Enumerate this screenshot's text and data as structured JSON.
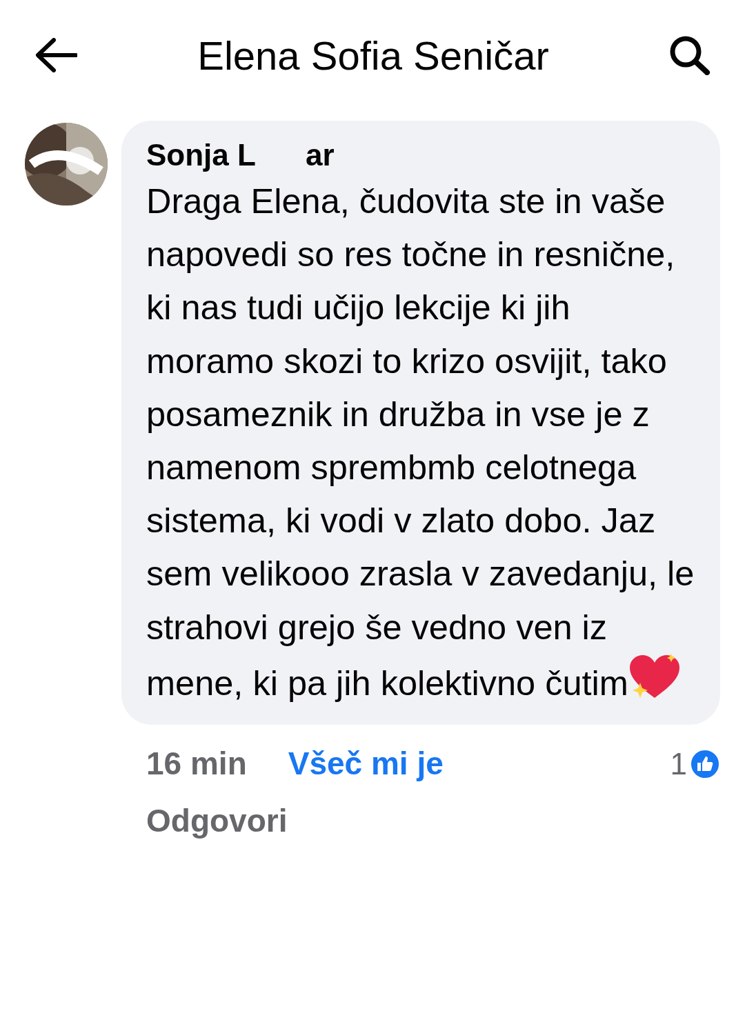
{
  "header": {
    "title": "Elena Sofia Seničar"
  },
  "comment": {
    "author_visible_parts": [
      "Sonja L",
      "ar"
    ],
    "text": "Draga Elena, čudovita ste in vaše napovedi so res točne in resnične, ki nas tudi učijo lekcije ki jih moramo skozi to krizo osvijit, tako posameznik in družba in vse je z namenom sprembmb celotnega sistema, ki vodi v zlato dobo. Jaz sem velikooo zrasla v zavedanju, le strahovi grejo še vedno ven iz mene, ki pa jih kolektivno čutim",
    "time": "16 min",
    "like_label": "Všeč mi je",
    "liked": true,
    "reaction_count": "1",
    "reply_label": "Odgovori"
  }
}
